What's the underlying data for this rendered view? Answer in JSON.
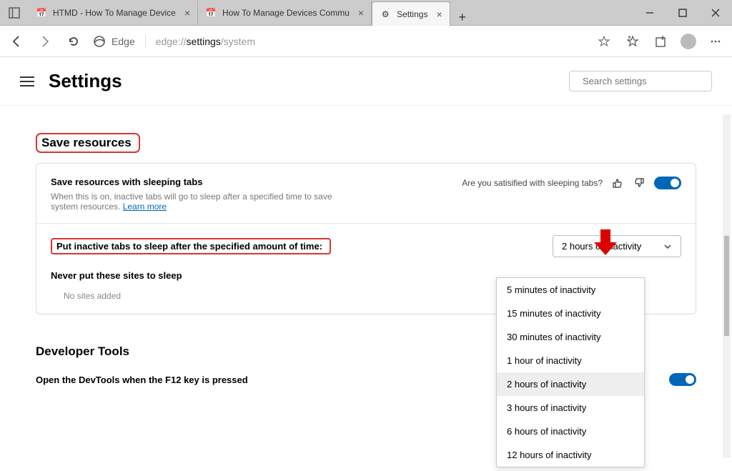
{
  "titlebar": {
    "tabs": [
      {
        "label": "HTMD - How To Manage Device",
        "icon": "📅"
      },
      {
        "label": "How To Manage Devices Commu",
        "icon": "📅"
      },
      {
        "label": "Settings",
        "icon": "⚙"
      }
    ]
  },
  "addressbar": {
    "brand": "Edge",
    "url_prefix": "edge://",
    "url_bold": "settings",
    "url_suffix": "/system"
  },
  "header": {
    "title": "Settings",
    "search_placeholder": "Search settings"
  },
  "save_resources": {
    "heading": "Save resources",
    "card": {
      "title": "Save resources with sleeping tabs",
      "desc_prefix": "When this is on, inactive tabs will go to sleep after a specified time to save system resources. ",
      "learn_more": "Learn more",
      "feedback_label": "Are you satisified with sleeping tabs?",
      "select_label": "Put inactive tabs to sleep after the specified amount of time:",
      "selected": "2 hours of inactivity",
      "never_title": "Never put these sites to sleep",
      "never_empty": "No sites added"
    },
    "options": [
      "5 minutes of inactivity",
      "15 minutes of inactivity",
      "30 minutes of inactivity",
      "1 hour of inactivity",
      "2 hours of inactivity",
      "3 hours of inactivity",
      "6 hours of inactivity",
      "12 hours of inactivity"
    ]
  },
  "dev_tools": {
    "heading": "Developer Tools",
    "row": "Open the DevTools when the F12 key is pressed"
  }
}
